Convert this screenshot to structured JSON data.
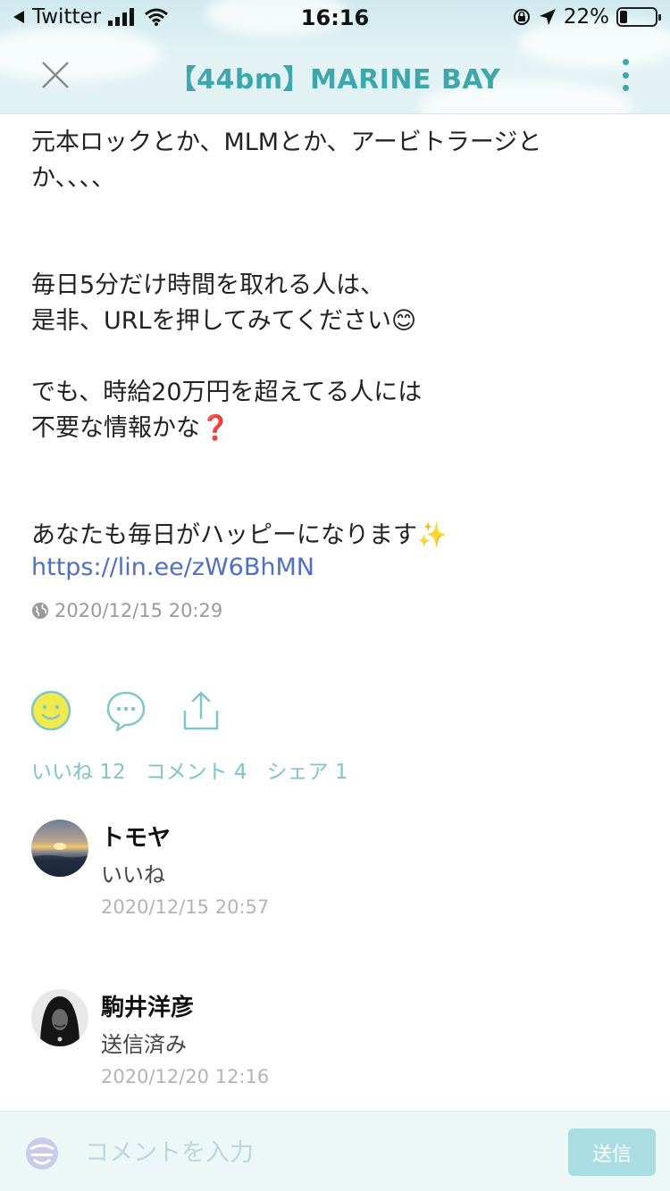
{
  "status_bar": {
    "back_app": "Twitter",
    "time": "16:16",
    "battery": "22%",
    "battery_level": 0.22
  },
  "header": {
    "title": "【44bm】MARINE BAY"
  },
  "post": {
    "body": "元本ロックとか、MLMとか、アービトラージと\nか、、、、\n\n\n毎日5分だけ時間を取れる人は、\n是非、URLを押してみてください😊\n\nでも、時給20万円を超えてる人には\n不要な情報かな❓\n\n\nあなたも毎日がハッピーになります✨",
    "link": "https://lin.ee/zW6BhMN",
    "timestamp": "2020/12/15 20:29"
  },
  "stats": {
    "likes": "いいね 12",
    "comments": "コメント 4",
    "shares": "シェア 1"
  },
  "comments": [
    {
      "name": "トモヤ",
      "text": "いいね",
      "time": "2020/12/15 20:57"
    },
    {
      "name": "駒井洋彦",
      "text": "送信済み",
      "time": "2020/12/20 12:16"
    }
  ],
  "input_bar": {
    "placeholder": "コメントを入力",
    "send_label": "送信"
  },
  "colors": {
    "accent": "#3ca7ad",
    "link": "#4d6fc4",
    "like_face": "#f1ea4f"
  }
}
